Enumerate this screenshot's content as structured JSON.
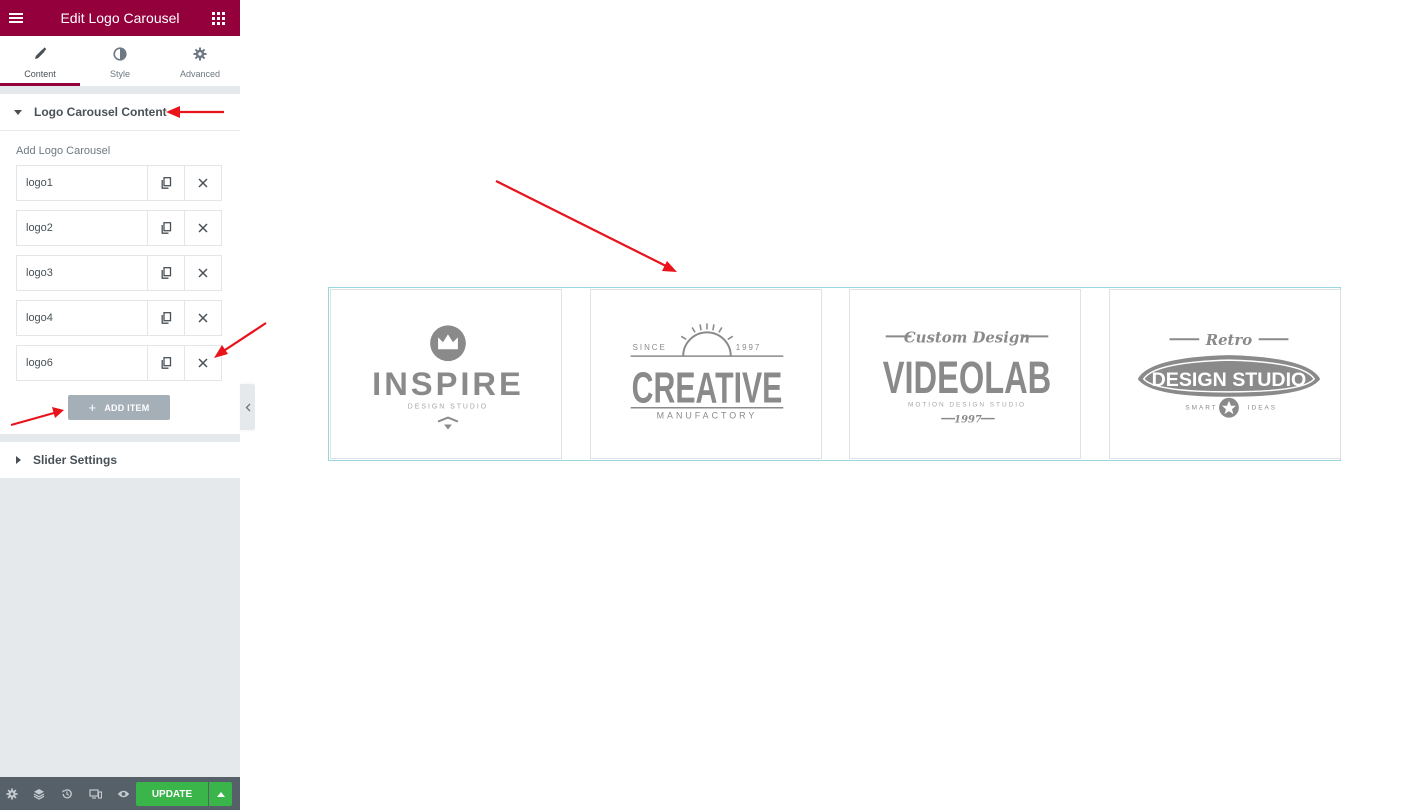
{
  "topbar": {
    "title": "Edit Logo Carousel"
  },
  "tabs": [
    {
      "label": "Content",
      "icon": "pencil-icon",
      "active": true
    },
    {
      "label": "Style",
      "icon": "half-circle-icon",
      "active": false
    },
    {
      "label": "Advanced",
      "icon": "gear-icon",
      "active": false
    }
  ],
  "content_section": {
    "title": "Logo Carousel Content",
    "field_label": "Add Logo Carousel",
    "items": [
      "logo1",
      "logo2",
      "logo3",
      "logo4",
      "logo6"
    ],
    "add_item_label": "ADD ITEM"
  },
  "slider_section": {
    "title": "Slider Settings"
  },
  "footer": {
    "update_label": "UPDATE"
  },
  "logos": [
    {
      "main": "INSPIRE",
      "sub": "DESIGN STUDIO"
    },
    {
      "main": "CREATIVE",
      "sub": "MANUFACTORY",
      "left": "SINCE",
      "right": "1997"
    },
    {
      "top": "Custom Design",
      "main": "VIDEOLAB",
      "sub": "MOTION DESIGN STUDIO",
      "year": "1997"
    },
    {
      "top": "Retro",
      "main": "DESIGN STUDIO",
      "left": "SMART",
      "right": "IDEAS"
    }
  ],
  "colors": {
    "brand": "#93003c",
    "update": "#39b54a",
    "logo_gray": "#8a8a8a",
    "annotation_arrow": "#e8131b",
    "carousel_border": "#9ad6df"
  }
}
